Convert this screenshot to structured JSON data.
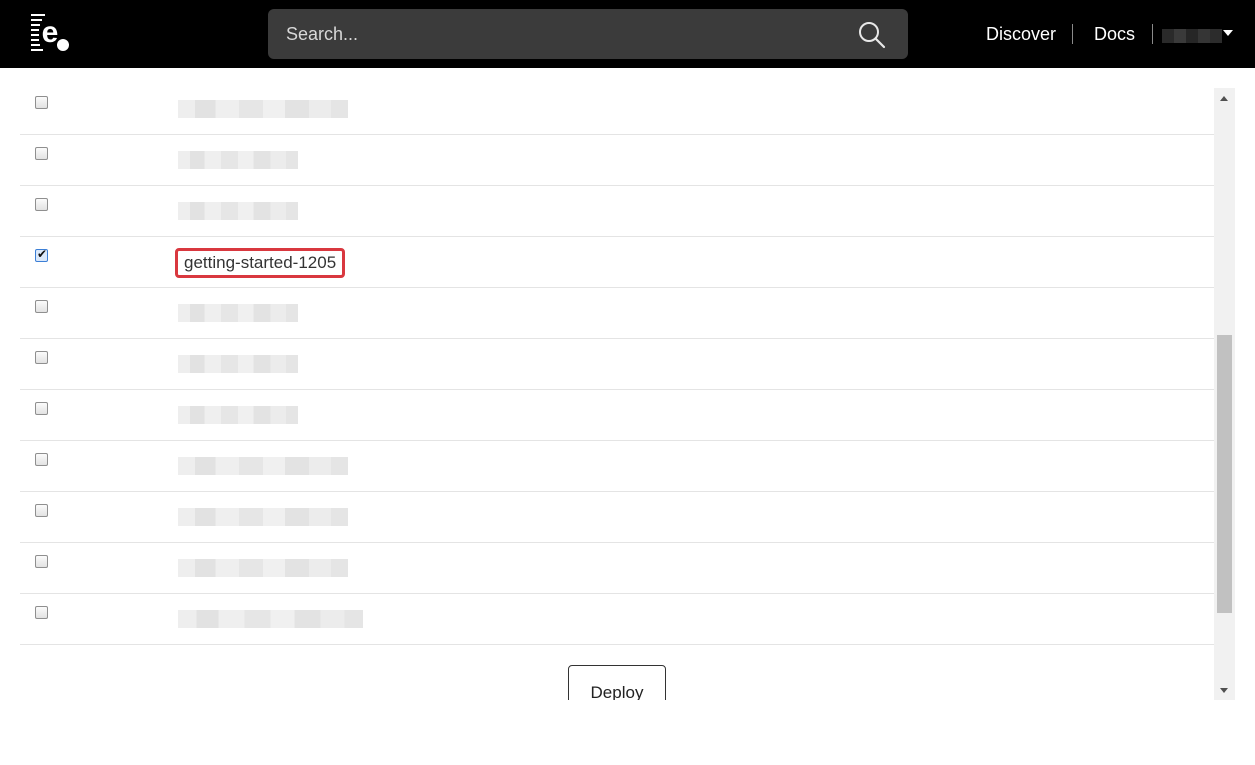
{
  "header": {
    "logo_letter": "e",
    "search": {
      "placeholder": "Search...",
      "value": ""
    },
    "nav": [
      {
        "label": "Discover"
      },
      {
        "label": "Docs"
      }
    ]
  },
  "list": {
    "rows": [
      {
        "checked": false,
        "name": ""
      },
      {
        "checked": false,
        "name": ""
      },
      {
        "checked": false,
        "name": ""
      },
      {
        "checked": true,
        "name": "getting-started-1205"
      },
      {
        "checked": false,
        "name": ""
      },
      {
        "checked": false,
        "name": ""
      },
      {
        "checked": false,
        "name": ""
      },
      {
        "checked": false,
        "name": ""
      },
      {
        "checked": false,
        "name": ""
      },
      {
        "checked": false,
        "name": ""
      },
      {
        "checked": false,
        "name": ""
      }
    ]
  },
  "actions": {
    "deploy_label": "Deploy"
  },
  "colors": {
    "topbar": "#000000",
    "search_bg": "#3b3b3b",
    "highlight_border": "#d9383f",
    "row_divider": "#e4e4e4"
  },
  "icons": [
    "e-logo-icon",
    "search-icon",
    "caret-down-icon",
    "checkmark-icon",
    "scroll-up-icon",
    "scroll-down-icon"
  ]
}
